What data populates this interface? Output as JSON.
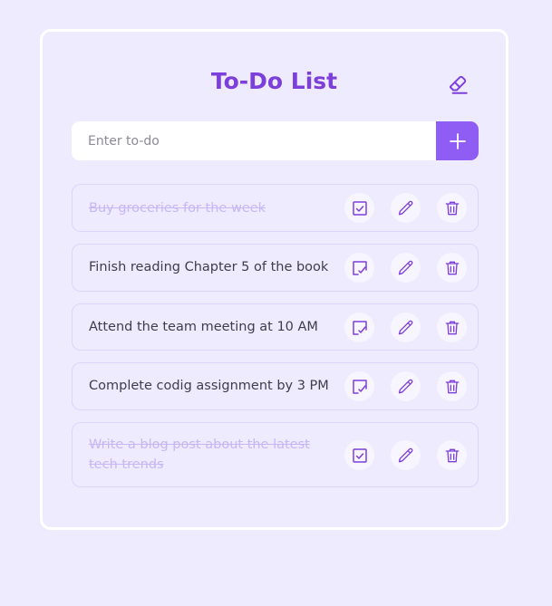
{
  "app": {
    "title": "To-Do List",
    "accent": "#7d3fdc",
    "button_color": "#8f5df3"
  },
  "input": {
    "placeholder": "Enter to-do",
    "value": ""
  },
  "icons": {
    "clear": "eraser-icon",
    "add": "plus-icon",
    "complete": "check-square-icon",
    "incomplete": "check-square-outline-icon",
    "edit": "pencil-icon",
    "delete": "trash-icon"
  },
  "todos": [
    {
      "text": "Buy groceries for the week",
      "completed": true
    },
    {
      "text": "Finish reading Chapter 5 of the book",
      "completed": false
    },
    {
      "text": "Attend the team meeting at 10 AM",
      "completed": false
    },
    {
      "text": "Complete codig assignment by 3 PM",
      "completed": false
    },
    {
      "text": "Write a blog post about the latest tech trends",
      "completed": true
    }
  ]
}
